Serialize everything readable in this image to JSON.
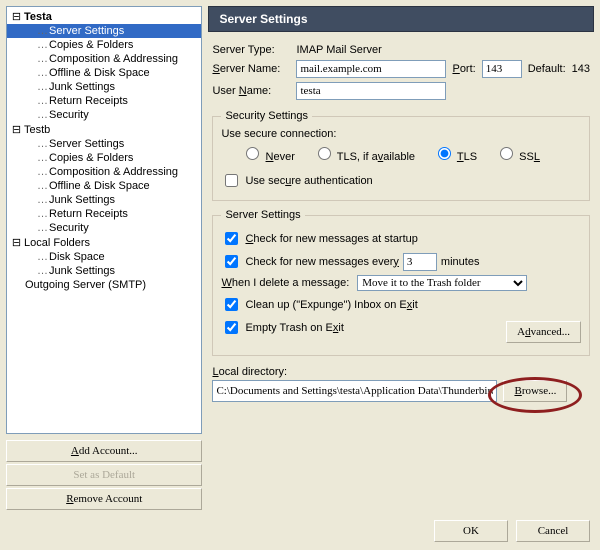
{
  "sidebar": {
    "accounts": [
      {
        "name": "Testa",
        "expanded": true,
        "items": [
          "Server Settings",
          "Copies & Folders",
          "Composition & Addressing",
          "Offline & Disk Space",
          "Junk Settings",
          "Return Receipts",
          "Security"
        ]
      },
      {
        "name": "Testb",
        "expanded": true,
        "items": [
          "Server Settings",
          "Copies & Folders",
          "Composition & Addressing",
          "Offline & Disk Space",
          "Junk Settings",
          "Return Receipts",
          "Security"
        ]
      },
      {
        "name": "Local Folders",
        "expanded": true,
        "items": [
          "Disk Space",
          "Junk Settings"
        ]
      }
    ],
    "outgoing": "Outgoing Server (SMTP)",
    "selected": "Server Settings",
    "buttons": {
      "add": "Add Account...",
      "default": "Set as Default",
      "remove": "Remove Account"
    }
  },
  "header": {
    "title": "Server Settings"
  },
  "basic": {
    "server_type_label": "Server Type:",
    "server_type_value": "IMAP Mail Server",
    "server_name_label": "Server Name:",
    "server_name_value": "mail.example.com",
    "port_label": "Port:",
    "port_value": "143",
    "default_label": "Default:",
    "default_value": "143",
    "user_name_label": "User Name:",
    "user_name_value": "testa"
  },
  "security": {
    "legend": "Security Settings",
    "secure_label": "Use secure connection:",
    "options": {
      "never": "Never",
      "tlsavail": "TLS, if available",
      "tls": "TLS",
      "ssl": "SSL"
    },
    "selected": "tls",
    "secure_auth_label": "Use secure authentication"
  },
  "server": {
    "legend": "Server Settings",
    "check_startup": "Check for new messages at startup",
    "check_every_pre": "Check for new messages every",
    "check_every_val": "3",
    "check_every_post": "minutes",
    "delete_label": "When I delete a message:",
    "delete_value": "Move it to the Trash folder",
    "expunge": "Clean up (\"Expunge\") Inbox on Exit",
    "empty_trash": "Empty Trash on Exit",
    "advanced": "Advanced..."
  },
  "local": {
    "label": "Local directory:",
    "value": "C:\\Documents and Settings\\testa\\Application Data\\Thunderbird",
    "browse": "Browse..."
  },
  "footer": {
    "ok": "OK",
    "cancel": "Cancel"
  }
}
